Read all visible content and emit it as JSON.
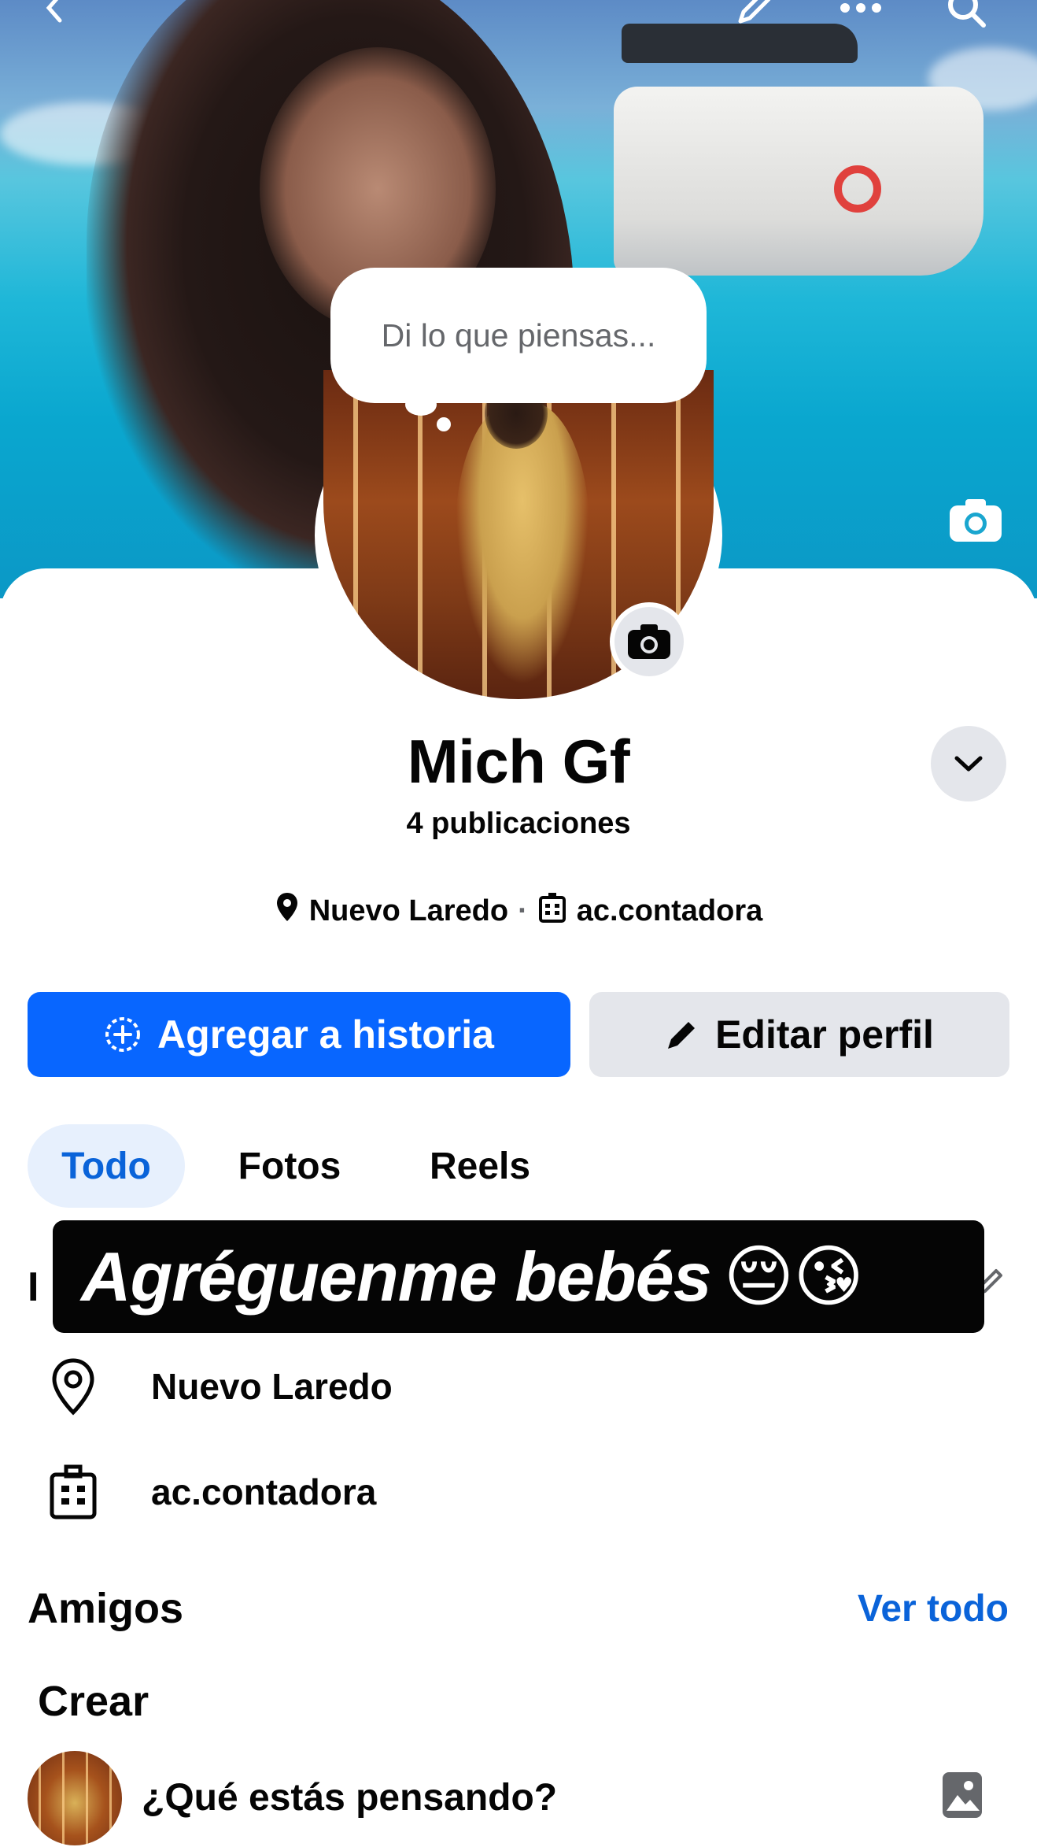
{
  "profile": {
    "name": "Mich Gf",
    "posts": "4 publicaciones",
    "location": "Nuevo Laredo",
    "separator": "·",
    "workplace": "ac.contadora"
  },
  "thought_bubble": {
    "placeholder": "Di lo que piensas..."
  },
  "actions": {
    "add_story": "Agregar a historia",
    "edit_profile": "Editar perfil"
  },
  "tabs": [
    {
      "label": "Todo",
      "active": true
    },
    {
      "label": "Fotos",
      "active": false
    },
    {
      "label": "Reels",
      "active": false
    }
  ],
  "intro": {
    "heading_visible": "I",
    "details": [
      {
        "icon": "location-pin-icon",
        "text": "Nuevo Laredo"
      },
      {
        "icon": "work-building-icon",
        "text": "ac.contadora"
      }
    ]
  },
  "overlay_sticker": {
    "text": "Agréguenme bebés",
    "emoji": "😔😘"
  },
  "friends": {
    "heading": "Amigos",
    "see_all": "Ver todo"
  },
  "create": {
    "heading": "Crear",
    "composer_prompt": "¿Qué estás pensando?"
  },
  "colors": {
    "primary": "#0866ff",
    "secondary_bg": "#e4e6eb",
    "active_tab_bg": "#e7f0fd",
    "link": "#0a63d9"
  }
}
